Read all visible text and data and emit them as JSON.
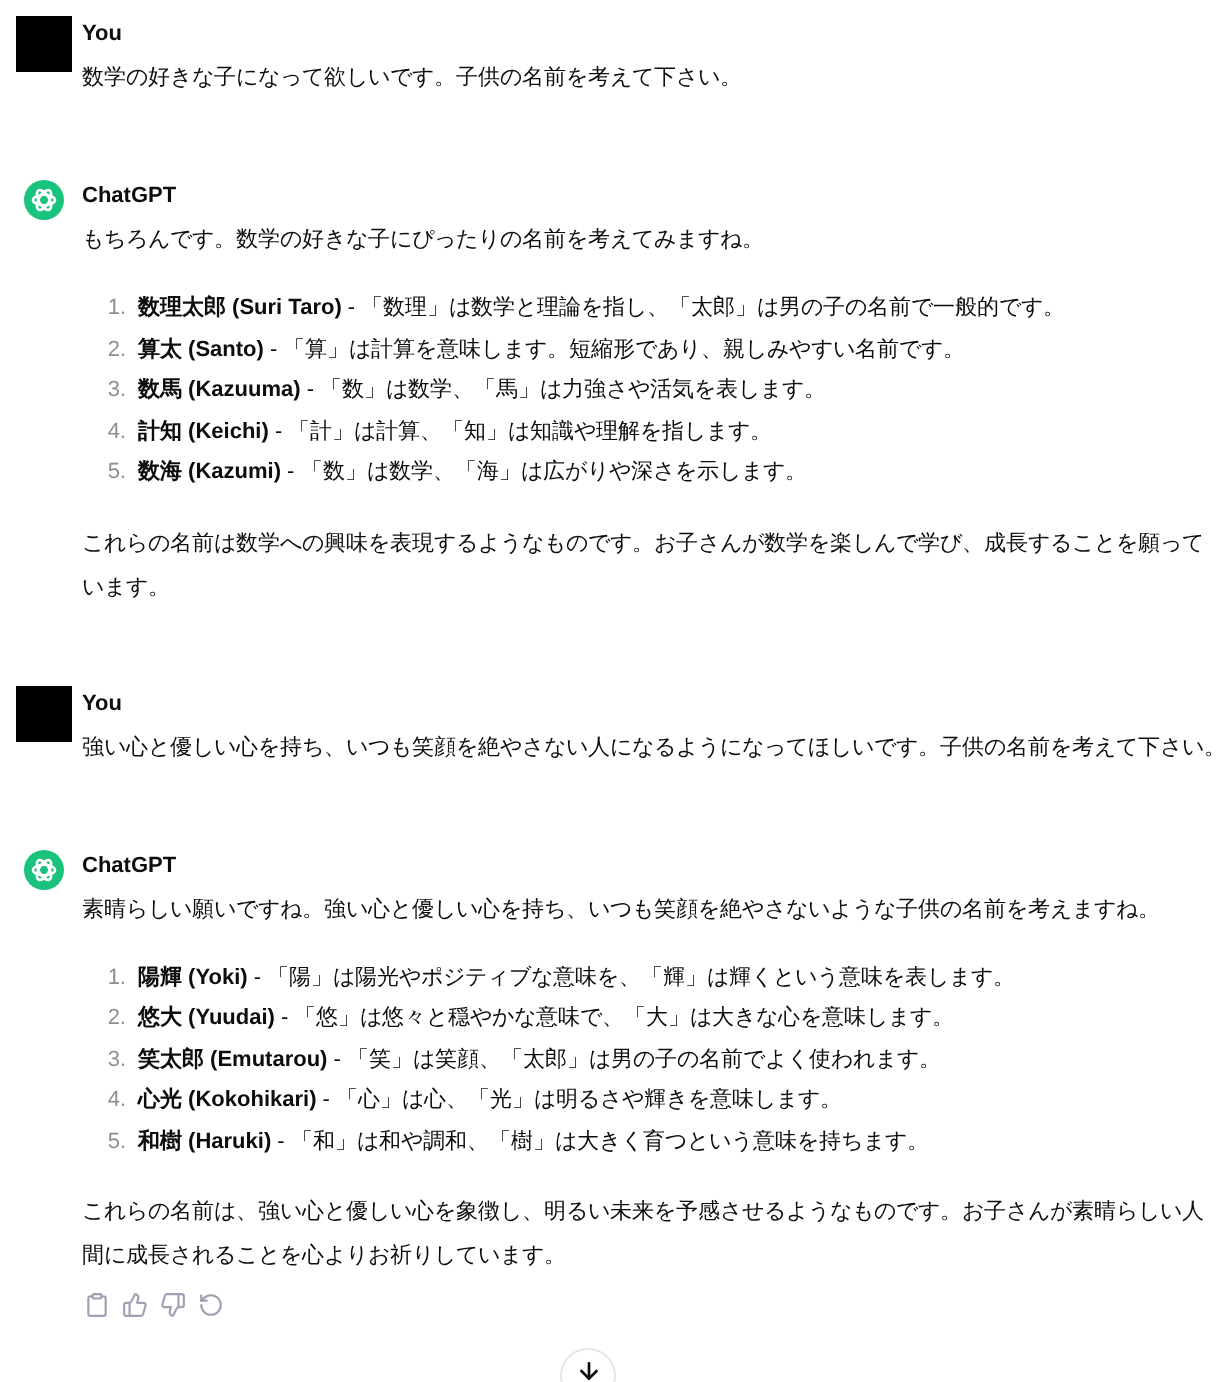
{
  "messages": [
    {
      "kind": "user",
      "author": "You",
      "text": "数学の好きな子になって欲しいです。子供の名前を考えて下さい。"
    },
    {
      "kind": "assistant",
      "author": "ChatGPT",
      "intro": "もちろんです。数学の好きな子にぴったりの名前を考えてみますね。",
      "items": [
        {
          "number": "1.",
          "text": "**数理太郎 (Suri Taro)** - 「数理」は数学と理論を指し、「太郎」は男の子の名前で一般的です。"
        },
        {
          "number": "2.",
          "text": "**算太 (Santo)** - 「算」は計算を意味します。短縮形であり、親しみやすい名前です。"
        },
        {
          "number": "3.",
          "text": "**数馬 (Kazuuma)** - 「数」は数学、「馬」は力強さや活気を表します。"
        },
        {
          "number": "4.",
          "text": "**計知 (Keichi)** - 「計」は計算、「知」は知識や理解を指します。"
        },
        {
          "number": "5.",
          "text": "**数海 (Kazumi)** - 「数」は数学、「海」は広がりや深さを示します。"
        }
      ],
      "conclusion": "これらの名前は数学への興味を表現するようなものです。お子さんが数学を楽しんで学び、成長することを願っています。",
      "actions": false
    },
    {
      "kind": "user",
      "author": "You",
      "text": "強い心と優しい心を持ち、いつも笑顔を絶やさない人になるようになってほしいです。子供の名前を考えて下さい。"
    },
    {
      "kind": "assistant",
      "author": "ChatGPT",
      "intro": "素晴らしい願いですね。強い心と優しい心を持ち、いつも笑顔を絶やさないような子供の名前を考えますね。",
      "items": [
        {
          "number": "1.",
          "text": "**陽輝 (Yoki)** - 「陽」は陽光やポジティブな意味を、「輝」は輝くという意味を表します。"
        },
        {
          "number": "2.",
          "text": "**悠大 (Yuudai)** - 「悠」は悠々と穏やかな意味で、「大」は大きな心を意味します。"
        },
        {
          "number": "3.",
          "text": "**笑太郎 (Emutarou)** - 「笑」は笑顔、「太郎」は男の子の名前でよく使われます。"
        },
        {
          "number": "4.",
          "text": "**心光 (Kokohikari)** - 「心」は心、「光」は明るさや輝きを意味します。"
        },
        {
          "number": "5.",
          "text": "**和樹 (Haruki)** - 「和」は和や調和、「樹」は大きく育つという意味を持ちます。"
        }
      ],
      "conclusion": "これらの名前は、強い心と優しい心を象徴し、明るい未来を予感させるようなものです。お子さんが素晴らしい人間に成長されることを心よりお祈りしています。",
      "actions": true
    }
  ]
}
